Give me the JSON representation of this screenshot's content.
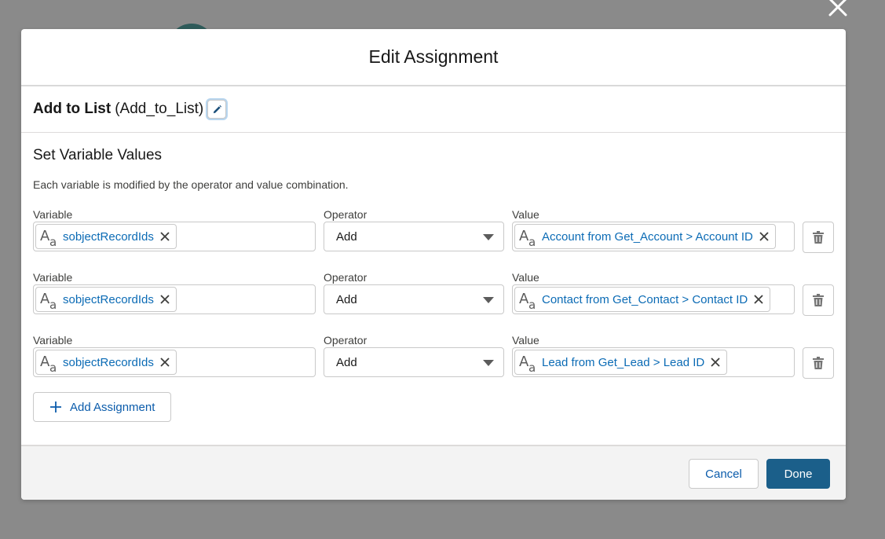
{
  "modal": {
    "title": "Edit Assignment"
  },
  "element": {
    "label": "Add to List",
    "api_name": "(Add_to_List)"
  },
  "section": {
    "title": "Set Variable Values",
    "description": "Each variable is modified by the operator and value combination."
  },
  "labels": {
    "variable": "Variable",
    "operator": "Operator",
    "value": "Value"
  },
  "assignments": [
    {
      "variable": "sobjectRecordIds",
      "operator": "Add",
      "value": "Account from Get_Account > Account ID"
    },
    {
      "variable": "sobjectRecordIds",
      "operator": "Add",
      "value": "Contact from Get_Contact > Contact ID"
    },
    {
      "variable": "sobjectRecordIds",
      "operator": "Add",
      "value": "Lead from Get_Lead > Lead ID"
    }
  ],
  "actions": {
    "add_assignment": "Add Assignment",
    "cancel": "Cancel",
    "done": "Done"
  },
  "icons": {
    "text_type": "text-type-icon",
    "remove": "close-icon",
    "dropdown": "chevron-down-icon",
    "delete": "trash-icon",
    "edit": "pencil-icon",
    "add": "plus-icon"
  },
  "colors": {
    "brand": "#1b5f8a",
    "link": "#0b6bb5",
    "overlay": "#8a8a8a"
  }
}
